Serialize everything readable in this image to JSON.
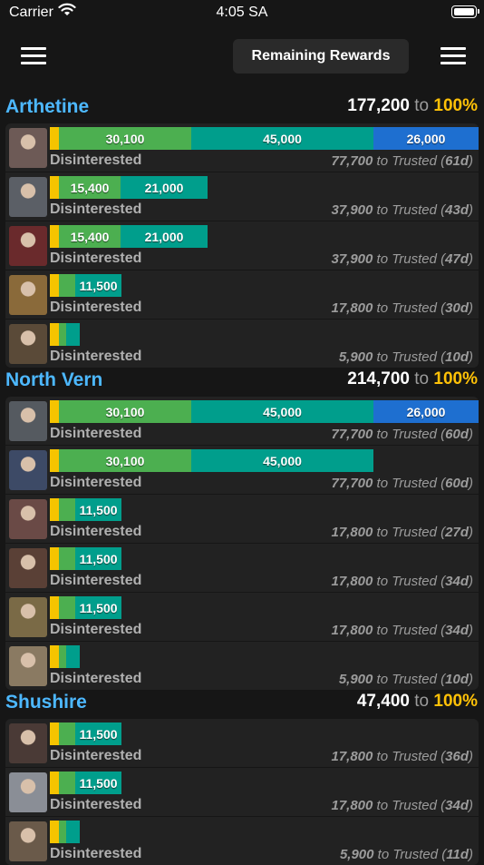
{
  "status_bar": {
    "carrier": "Carrier",
    "time": "4:05 SA"
  },
  "nav": {
    "center_button": "Remaining Rewards"
  },
  "colors": {
    "accent": "#4db8ff",
    "gold": "#ffc107",
    "yellow": "#f5c400",
    "green": "#4caf50",
    "teal": "#009e8c",
    "blue": "#1e6fd0"
  },
  "sections": [
    {
      "name": "Arthetine",
      "total": "177,200",
      "to": "to",
      "pct": "100%",
      "rows": [
        {
          "segs": [
            "30,100",
            "45,000",
            "26,000"
          ],
          "status": "Disinterested",
          "points": "77,700",
          "to_label": "to Trusted",
          "days": "61d",
          "avatar": "#6d5a56"
        },
        {
          "segs": [
            "15,400",
            "21,000"
          ],
          "status": "Disinterested",
          "points": "37,900",
          "to_label": "to Trusted",
          "days": "43d",
          "avatar": "#5b5f66"
        },
        {
          "segs": [
            "15,400",
            "21,000"
          ],
          "status": "Disinterested",
          "points": "37,900",
          "to_label": "to Trusted",
          "days": "47d",
          "avatar": "#6a2a2c"
        },
        {
          "segs": [
            "11,500"
          ],
          "status": "Disinterested",
          "points": "17,800",
          "to_label": "to Trusted",
          "days": "30d",
          "avatar": "#8a6a3a"
        },
        {
          "segs": [],
          "status": "Disinterested",
          "points": "5,900",
          "to_label": "to Trusted",
          "days": "10d",
          "avatar": "#5a4a38"
        }
      ]
    },
    {
      "name": "North Vern",
      "total": "214,700",
      "to": "to",
      "pct": "100%",
      "rows": [
        {
          "segs": [
            "30,100",
            "45,000",
            "26,000"
          ],
          "status": "Disinterested",
          "points": "77,700",
          "to_label": "to Trusted",
          "days": "60d",
          "avatar": "#555a60"
        },
        {
          "segs": [
            "30,100",
            "45,000"
          ],
          "status": "Disinterested",
          "points": "77,700",
          "to_label": "to Trusted",
          "days": "60d",
          "avatar": "#3d4a66"
        },
        {
          "segs": [
            "11,500"
          ],
          "status": "Disinterested",
          "points": "17,800",
          "to_label": "to Trusted",
          "days": "27d",
          "avatar": "#6a4a46"
        },
        {
          "segs": [
            "11,500"
          ],
          "status": "Disinterested",
          "points": "17,800",
          "to_label": "to Trusted",
          "days": "34d",
          "avatar": "#5a4036"
        },
        {
          "segs": [
            "11,500"
          ],
          "status": "Disinterested",
          "points": "17,800",
          "to_label": "to Trusted",
          "days": "34d",
          "avatar": "#7a6a46"
        },
        {
          "segs": [],
          "status": "Disinterested",
          "points": "5,900",
          "to_label": "to Trusted",
          "days": "10d",
          "avatar": "#8a7a62"
        }
      ]
    },
    {
      "name": "Shushire",
      "total": "47,400",
      "to": "to",
      "pct": "100%",
      "rows": [
        {
          "segs": [
            "11,500"
          ],
          "status": "Disinterested",
          "points": "17,800",
          "to_label": "to Trusted",
          "days": "36d",
          "avatar": "#4a3a36"
        },
        {
          "segs": [
            "11,500"
          ],
          "status": "Disinterested",
          "points": "17,800",
          "to_label": "to Trusted",
          "days": "34d",
          "avatar": "#8a8e96"
        },
        {
          "segs": [],
          "status": "Disinterested",
          "points": "5,900",
          "to_label": "to Trusted",
          "days": "11d",
          "avatar": "#6a5a4a"
        }
      ]
    }
  ]
}
